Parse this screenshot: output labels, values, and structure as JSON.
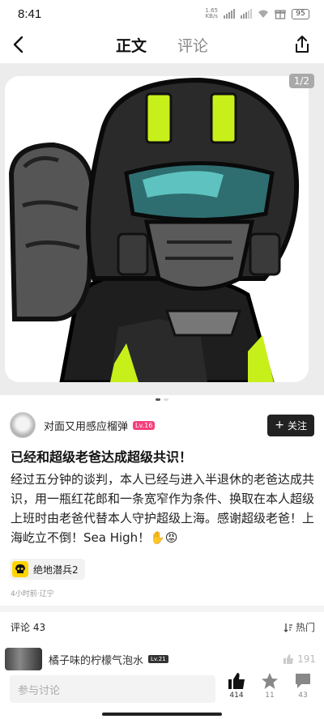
{
  "status_bar": {
    "time": "8:41",
    "net_speed": "1.65",
    "net_unit": "KB/s",
    "battery": "95"
  },
  "nav": {
    "tabs": [
      {
        "label": "正文"
      },
      {
        "label": "评论"
      }
    ]
  },
  "media": {
    "counter": "1/2"
  },
  "author": {
    "name": "对面又用感应榴弹",
    "level": "Lv.16",
    "follow_label": "关注"
  },
  "post": {
    "title": "已经和超级老爸达成超级共识！",
    "body": "经过五分钟的谈判，本人已经与进入半退休的老爸达成共识，用一瓶红花郎和一条宽窄作为条件、换取在本人超级上班时由老爸代替本人守护超级上海。感谢超级老爸！上海屹立不倒！Sea High！✋😡",
    "game_tag": "绝地潜兵2",
    "meta": "4小时前·辽宁"
  },
  "comments": {
    "header": "评论 43",
    "sort_label": "热门",
    "items": [
      {
        "name": "橘子味的柠檬气泡水",
        "level": "Lv.21",
        "likes": "191"
      }
    ]
  },
  "bottom": {
    "placeholder": "参与讨论",
    "like_count": "414",
    "star_count": "11",
    "comment_count": "43"
  },
  "colors": {
    "level_badge": "#f4407b",
    "game_icon": "#ffd400",
    "visor_accent": "#c7f01a"
  }
}
